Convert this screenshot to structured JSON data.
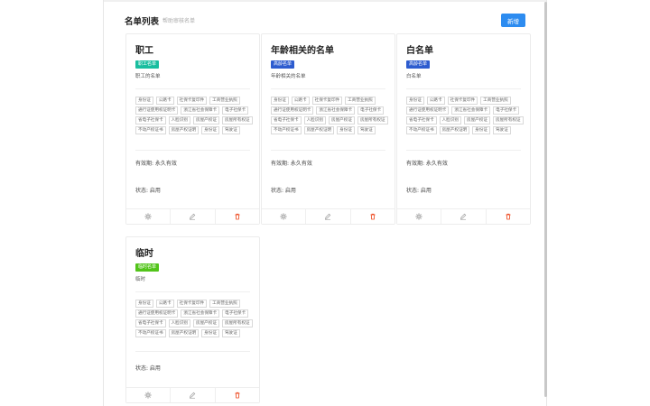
{
  "header": {
    "title": "名单列表",
    "subtitle": "帮助审核名单",
    "add_label": "新增"
  },
  "colors": {
    "primary": "#2d8cf0",
    "badge_teal": "#19be9f",
    "badge_blue": "#2d5ccf",
    "badge_green": "#52c41a",
    "delete_red": "#ed4014"
  },
  "tags": [
    "身份证",
    "公路卡",
    "社保卡复印件",
    "工商营业执照",
    "通行证使用权证明卡",
    "浙江省社会保障卡",
    "电子社保卡",
    "省电子社保卡",
    "人脸识别",
    "房屋产权证",
    "房屋所有权证",
    "不动产权证书",
    "房屋产权证明",
    "身份证",
    "驾驶证"
  ],
  "cards": [
    {
      "title": "职工",
      "badge": "职工名单",
      "badge_color": "#19be9f",
      "desc": "职工的名单",
      "validity": "有效期: 永久有效",
      "status": "状态: 启用"
    },
    {
      "title": "年龄相关的名单",
      "badge": "高龄名单",
      "badge_color": "#2d5ccf",
      "desc": "年龄相关的名单",
      "validity": "有效期: 永久有效",
      "status": "状态: 启用"
    },
    {
      "title": "白名单",
      "badge": "高龄名单",
      "badge_color": "#2d5ccf",
      "desc": "白名单",
      "validity": "有效期: 永久有效",
      "status": "状态: 启用"
    },
    {
      "title": "临时",
      "badge": "临时名单",
      "badge_color": "#52c41a",
      "desc": "临时",
      "validity": "",
      "status": "状态: 启用"
    }
  ],
  "icons": {
    "settings": "gear-icon",
    "edit": "pencil-icon",
    "delete": "trash-icon"
  }
}
